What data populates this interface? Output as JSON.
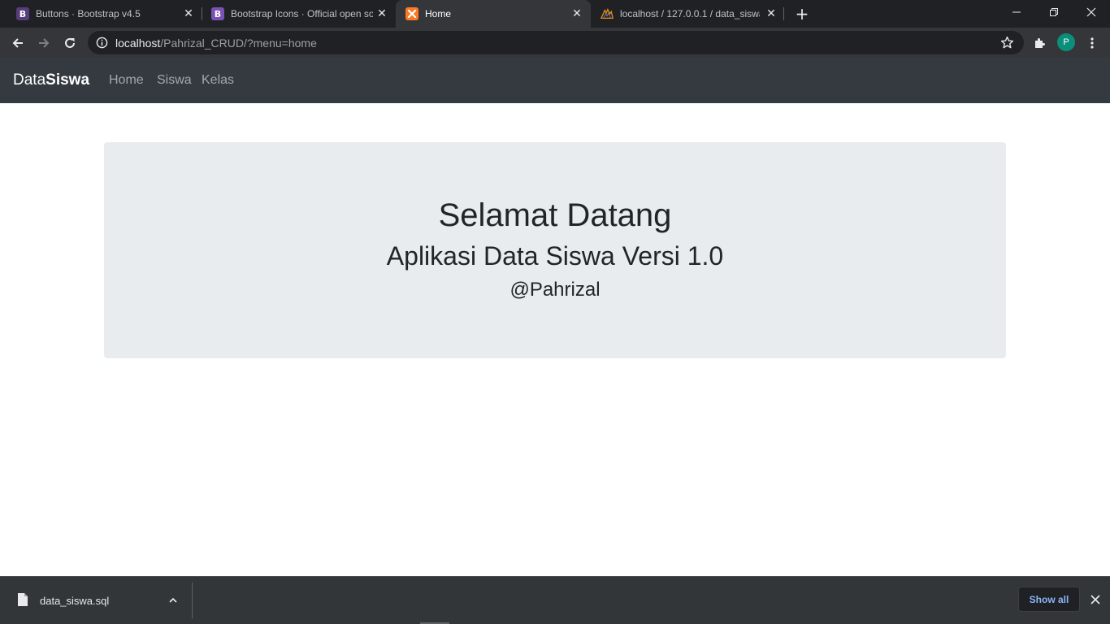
{
  "browser": {
    "tabs": [
      {
        "title": "Buttons · Bootstrap v4.5",
        "favicon": "bootstrap-icon",
        "favicon_letter": "B",
        "favicon_color": "#563d7c"
      },
      {
        "title": "Bootstrap Icons · Official open so",
        "favicon": "bootstrap-icon",
        "favicon_letter": "B",
        "favicon_color": "#7952b3"
      },
      {
        "title": "Home",
        "favicon": "xampp-icon",
        "favicon_color": "#fb7a24",
        "active": true
      },
      {
        "title": "localhost / 127.0.0.1 / data_siswa",
        "favicon": "phpmyadmin-icon"
      }
    ],
    "address_bar": {
      "host": "localhost",
      "path": "/Pahrizal_CRUD/?menu=home"
    },
    "profile_initial": "P",
    "profile_color": "#0a8f7a"
  },
  "navbar": {
    "brand_light": "Data",
    "brand_bold": "Siswa",
    "links": [
      "Home",
      "Siswa",
      "Kelas"
    ],
    "background": "#343a40"
  },
  "jumbotron": {
    "heading": "Selamat Datang",
    "subheading": "Aplikasi Data Siswa Versi 1.0",
    "author": "@Pahrizal",
    "background": "#e9ecef"
  },
  "download_shelf": {
    "file_name": "data_siswa.sql",
    "show_all_label": "Show all",
    "accent": "#8ab4f8"
  }
}
